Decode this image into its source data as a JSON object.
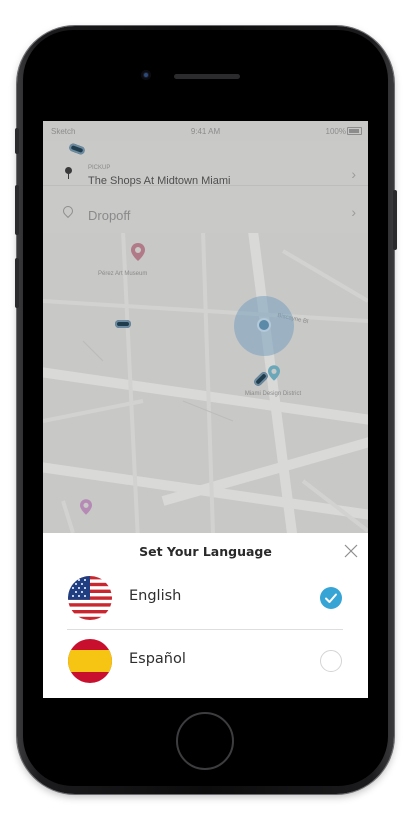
{
  "status_bar": {
    "carrier": "Sketch",
    "time": "9:41 AM",
    "battery": "100%"
  },
  "trip": {
    "pickup_caption": "PICKUP",
    "pickup_address": "The Shops At Midtown Miami",
    "dropoff_placeholder": "Dropoff"
  },
  "map": {
    "poi_label": "Pérez Art Museum",
    "place_label": "Miami Design District",
    "street_label": "Biscayne Bl"
  },
  "language_sheet": {
    "title": "Set Your Language",
    "options": [
      {
        "label": "English",
        "flag": "us-flag-icon",
        "selected": true
      },
      {
        "label": "Español",
        "flag": "spain-flag-icon",
        "selected": false
      }
    ]
  },
  "colors": {
    "accent": "#37a4d6",
    "overlay_map": "#c7c7c6",
    "device_frame": "#0c0c0d"
  }
}
